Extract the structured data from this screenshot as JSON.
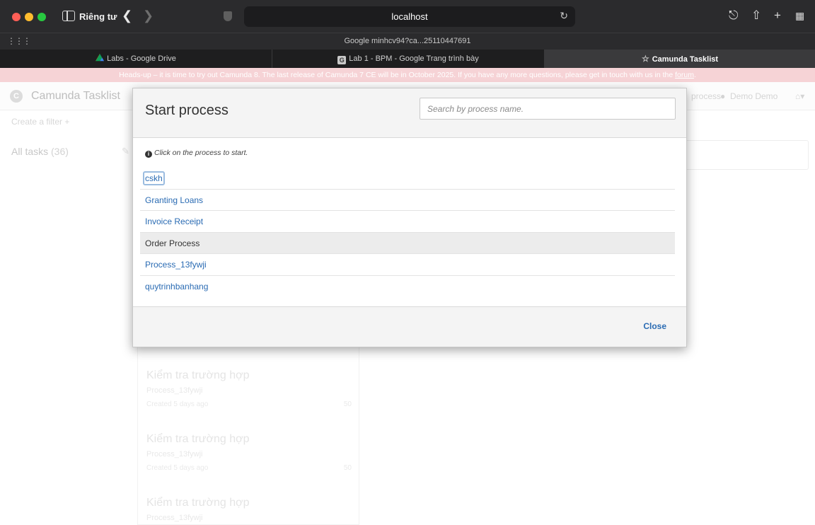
{
  "browser": {
    "private_label": "Riêng tư",
    "address": "localhost",
    "site_hint": "Google   minhcv94?ca...25110447691",
    "tabs": [
      {
        "label": "Labs - Google Drive"
      },
      {
        "label": "Lab 1 - BPM - Google Trang trình bày"
      },
      {
        "label": "Camunda Tasklist"
      }
    ]
  },
  "banner": {
    "text": "Heads-up – it is time to try out Camunda 8. The last release of Camunda 7 CE will be in October 2025. If you have any more questions, please get in touch with us in the ",
    "link": "forum",
    "end": "."
  },
  "app": {
    "logo_letter": "C",
    "name": "Camunda Tasklist",
    "header_start_process": "process",
    "header_user": "Demo Demo",
    "create_filter": "Create a filter +",
    "filter_name": "All tasks",
    "filter_count": "(36)",
    "tasks": [
      {
        "title": "Kiểm tra trường hợp",
        "process": "Process_13fywji",
        "created": "Created 5 days ago",
        "priority": "50"
      },
      {
        "title": "Kiểm tra trường hợp",
        "process": "Process_13fywji",
        "created": "Created 5 days ago",
        "priority": "50"
      },
      {
        "title": "Kiểm tra trường hợp",
        "process": "Process_13fywji",
        "created": "",
        "priority": ""
      }
    ]
  },
  "modal": {
    "title": "Start process",
    "search_placeholder": "Search by process name.",
    "hint": "Click on the process to start.",
    "processes": [
      {
        "label": "cskh"
      },
      {
        "label": "Granting Loans"
      },
      {
        "label": "Invoice Receipt"
      },
      {
        "label": "Order Process"
      },
      {
        "label": "Process_13fywji"
      },
      {
        "label": "quytrinhbanhang"
      }
    ],
    "close_label": "Close"
  },
  "colors": {
    "link": "#2a6bb3",
    "banner": "#f6d3d6",
    "hover_row": "#ececec"
  }
}
